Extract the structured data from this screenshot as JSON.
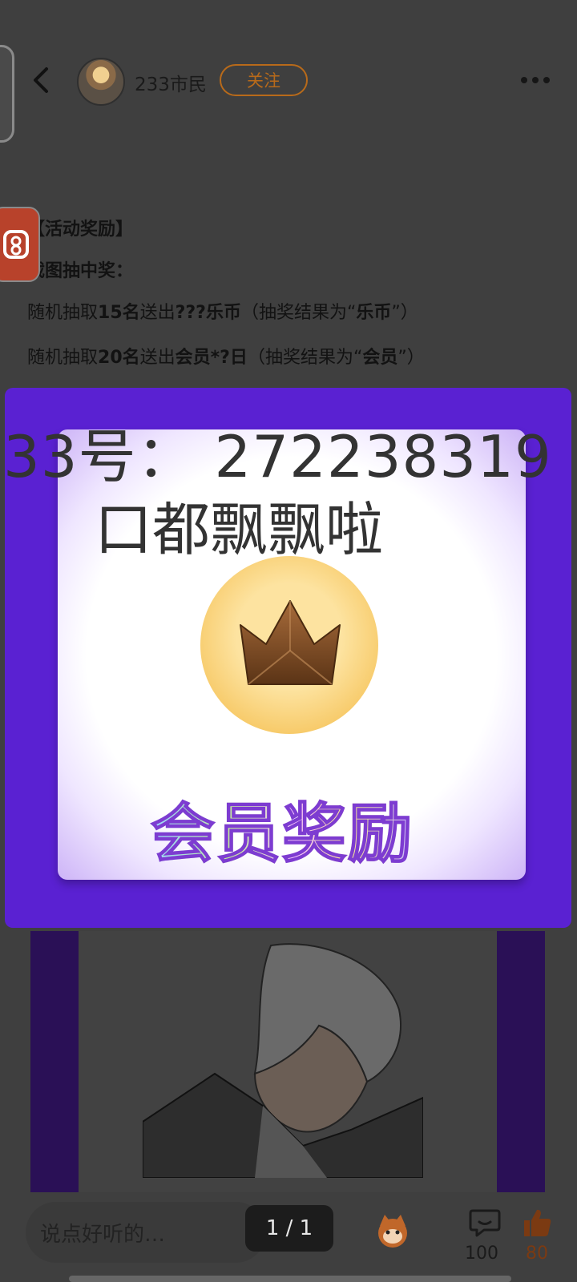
{
  "header": {
    "username": "233市民",
    "follow_label": "关注"
  },
  "article": {
    "heading": "【活动奖励】",
    "sub_heading": "截图抽中奖：",
    "line1": {
      "p1": "随机抽取",
      "n1": "15名",
      "p2": "送出",
      "n2": "???乐币",
      "p3": "（抽奖结果为“",
      "n3": "乐币",
      "p4": "”）"
    },
    "line2": {
      "p1": "随机抽取",
      "n1": "20名",
      "p2": "送出",
      "n2": "会员*?日",
      "p3": "（抽奖结果为“",
      "n3": "会员",
      "p4": "”）"
    }
  },
  "promo": {
    "overlay_line1": "33号： 272238319",
    "overlay_line2": "口都飘飘啦",
    "reward_title": "会员奖励"
  },
  "bottom_bar": {
    "comment_placeholder": "说点好听的…",
    "pager": "1 / 1",
    "comment_count": "100",
    "like_count": "80"
  },
  "colors": {
    "accent": "#b86a1a",
    "promo_bg": "#5a21d2"
  },
  "icons": [
    "back-arrow-icon",
    "more-icon",
    "mascot-icon",
    "comment-icon",
    "like-icon"
  ]
}
